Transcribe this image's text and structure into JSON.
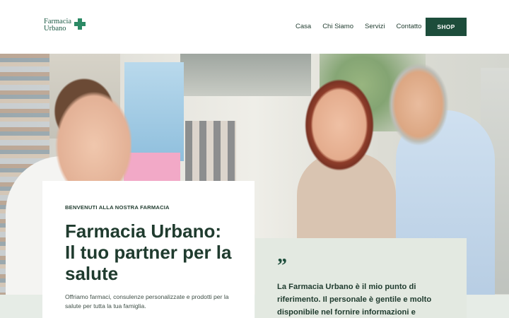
{
  "header": {
    "logo": {
      "line1": "Farmacia",
      "line2": "Urbano",
      "icon": "pharmacy-cross-icon",
      "color": "#2c8a65"
    },
    "nav": [
      "Casa",
      "Chi Siamo",
      "Servizi",
      "Contatto"
    ],
    "shop_label": "SHOP"
  },
  "hero": {
    "eyebrow": "BENVENUTI ALLA NOSTRA FARMACIA",
    "title_lines": [
      "Farmacia Urbano:",
      "Il tuo partner per la",
      "salute"
    ],
    "description_lines": [
      "Offriamo farmaci, consulenze personalizzate e prodotti per la",
      "salute per tutta la tua famiglia."
    ]
  },
  "testimonial": {
    "quote_mark": "”",
    "lines": [
      "La Farmacia Urbano è il mio punto di",
      "riferimento. Il personale è gentile e molto",
      "disponibile nel fornire informazioni e"
    ]
  },
  "colors": {
    "primary": "#1d4d3b",
    "accent": "#2c8a65",
    "testimonial_bg": "#e3e9e1"
  }
}
